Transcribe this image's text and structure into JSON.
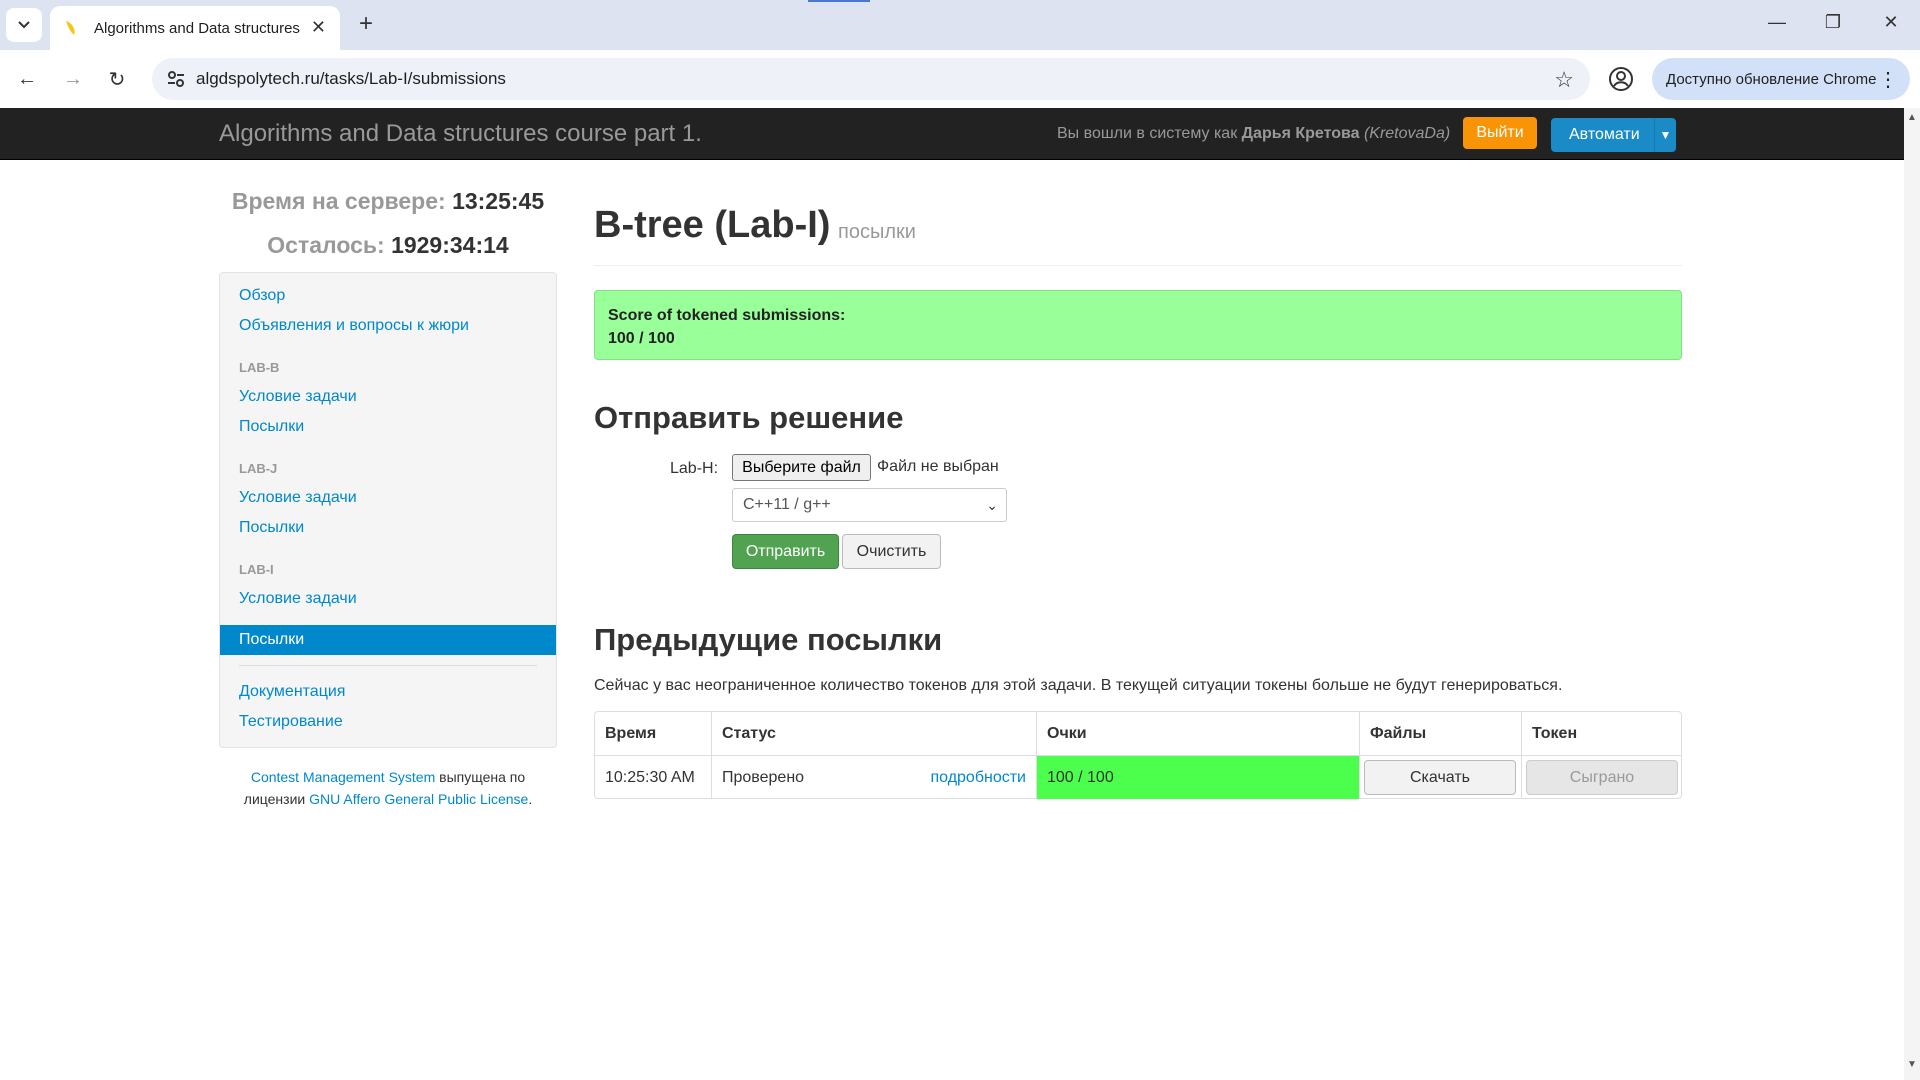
{
  "browser": {
    "tab_title": "Algorithms and Data structures",
    "url": "algdspolytech.ru/tasks/Lab-I/submissions",
    "update_label": "Доступно обновление Chrome"
  },
  "navbar": {
    "brand": "Algorithms and Data structures course part 1.",
    "logged_prefix": "Вы вошли в систему как",
    "user_name": "Дарья Кретова",
    "user_login": "(KretovaDa)",
    "logout_label": "Выйти",
    "auto_label": "Автомати"
  },
  "clock": {
    "server_time_label": "Время на сервере:",
    "server_time": "13:25:45",
    "remaining_label": "Осталось:",
    "remaining": "1929:34:14"
  },
  "sidebar": {
    "overview": "Обзор",
    "announcements": "Объявления и вопросы к жюри",
    "groups": [
      {
        "header": "LAB-B",
        "statement": "Условие задачи",
        "submissions": "Посылки"
      },
      {
        "header": "LAB-J",
        "statement": "Условие задачи",
        "submissions": "Посылки"
      },
      {
        "header": "LAB-I",
        "statement": "Условие задачи",
        "submissions": "Посылки"
      }
    ],
    "documentation": "Документация",
    "testing": "Тестирование"
  },
  "license": {
    "cms": "Contest Management System",
    "text1": " выпущена по",
    "text2": "лицензии ",
    "gnu": "GNU Affero General Public License",
    "dot": "."
  },
  "main": {
    "title": "B-tree (Lab-I)",
    "subtitle": "посылки",
    "alert_title": "Score of tokened submissions:",
    "alert_score": "100 / 100",
    "submit_heading": "Отправить решение",
    "file_label": "Lab-H:",
    "file_button": "Выберите файл",
    "file_none": "Файл не выбран",
    "language": "C++11 / g++",
    "submit_button": "Отправить",
    "clear_button": "Очистить",
    "prev_heading": "Предыдущие посылки",
    "token_info": "Сейчас у вас неограниченное количество токенов для этой задачи. В текущей ситуации токены больше не будут генерироваться."
  },
  "table": {
    "headers": [
      "Время",
      "Статус",
      "Очки",
      "Файлы",
      "Токен"
    ],
    "rows": [
      {
        "time": "10:25:30 AM",
        "status": "Проверено",
        "details": "подробности",
        "score": "100 / 100",
        "files": "Скачать",
        "token": "Сыграно"
      }
    ]
  }
}
